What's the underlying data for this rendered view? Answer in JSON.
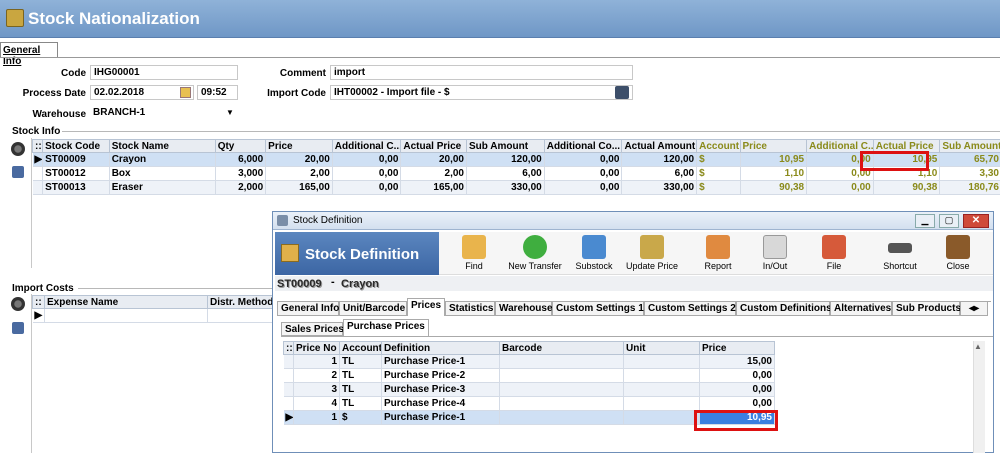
{
  "app": {
    "title": "Stock Nationalization"
  },
  "tab_general_info": "General Info",
  "form": {
    "code_label": "Code",
    "code": "IHG00001",
    "process_date_label": "Process Date",
    "process_date": "02.02.2018",
    "process_time": "09:52",
    "warehouse_label": "Warehouse",
    "warehouse": "BRANCH-1",
    "comment_label": "Comment",
    "comment": "import",
    "import_code_label": "Import Code",
    "import_code": "IHT00002 - Import file - $"
  },
  "stock_info": {
    "section_label": "Stock Info",
    "columns": [
      "Stock Code",
      "Stock Name",
      "Qty",
      "Price",
      "Additional C...",
      "Actual Price",
      "Sub Amount",
      "Additional Co...",
      "Actual Amount",
      "Account",
      "Price",
      "Additional C...",
      "Actual Price",
      "Sub Amount"
    ],
    "rows": [
      [
        "ST00009",
        "Crayon",
        "6,000",
        "20,00",
        "0,00",
        "20,00",
        "120,00",
        "0,00",
        "120,00",
        "$",
        "10,95",
        "0,00",
        "10,95",
        "65,70"
      ],
      [
        "ST00012",
        "Box",
        "3,000",
        "2,00",
        "0,00",
        "2,00",
        "6,00",
        "0,00",
        "6,00",
        "$",
        "1,10",
        "0,00",
        "1,10",
        "3,30"
      ],
      [
        "ST00013",
        "Eraser",
        "2,000",
        "165,00",
        "0,00",
        "165,00",
        "330,00",
        "0,00",
        "330,00",
        "$",
        "90,38",
        "0,00",
        "90,38",
        "180,76"
      ]
    ]
  },
  "import_costs": {
    "section_label": "Import Costs",
    "columns": [
      "Expense Name",
      "Distr. Method"
    ]
  },
  "stock_definition": {
    "window_title": "Stock Definition",
    "header_title": "Stock Definition",
    "toolbar": [
      "Find",
      "New Transfer",
      "Substock",
      "Update Price",
      "Report",
      "In/Out",
      "File",
      "Shortcut",
      "Close"
    ],
    "record_code": "ST00009",
    "record_sep": "-",
    "record_name": "Crayon",
    "tabs": [
      "General Info",
      "Unit/Barcode",
      "Prices",
      "Statistics",
      "Warehouse",
      "Custom Settings 1",
      "Custom Settings 2",
      "Custom Definitions",
      "Alternatives",
      "Sub Products"
    ],
    "price_tabs": [
      "Sales Prices",
      "Purchase Prices"
    ],
    "price_columns": [
      "Price No",
      "Account",
      "Definition",
      "Barcode",
      "Unit",
      "Price"
    ],
    "price_rows": [
      [
        "1",
        "TL",
        "Purchase Price-1",
        "",
        "",
        "15,00"
      ],
      [
        "2",
        "TL",
        "Purchase Price-2",
        "",
        "",
        "0,00"
      ],
      [
        "3",
        "TL",
        "Purchase Price-3",
        "",
        "",
        "0,00"
      ],
      [
        "4",
        "TL",
        "Purchase Price-4",
        "",
        "",
        "0,00"
      ],
      [
        "1",
        "$",
        "Purchase Price-1",
        "",
        "",
        "10,95"
      ]
    ]
  },
  "colors": {
    "title_bar": "#7aa0cc",
    "highlight": "#d11111",
    "selected_cell": "#3a7fe0",
    "gold_text": "#8a8a1a"
  }
}
